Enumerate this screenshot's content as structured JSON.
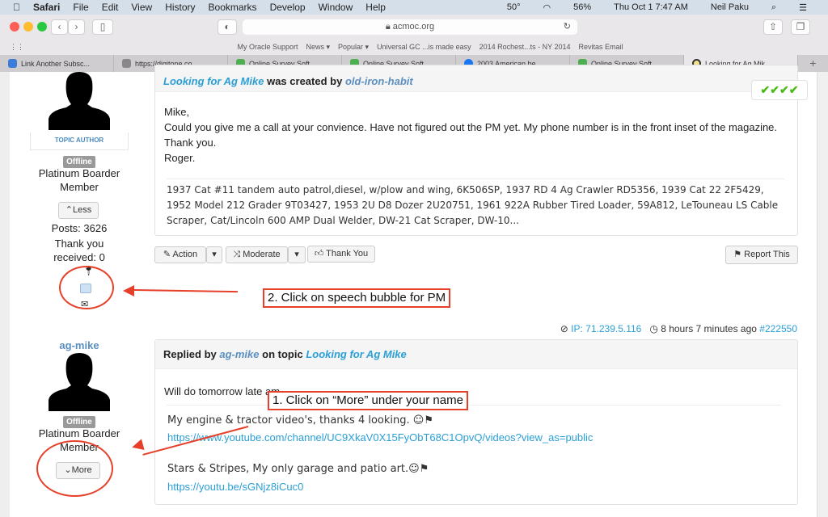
{
  "menubar": {
    "app": "Safari",
    "items": [
      "File",
      "Edit",
      "View",
      "History",
      "Bookmarks",
      "Develop",
      "Window",
      "Help"
    ],
    "weather": "50°",
    "battery": "56%",
    "datetime": "Thu Oct 1  7:47 AM",
    "user": "Neil Paku"
  },
  "browser": {
    "url": "acmoc.org",
    "bookmarks": [
      "My Oracle Support",
      "News ▾",
      "Popular ▾",
      "Universal GC ...is made easy",
      "2014 Rochest...ts - NY 2014",
      "Revitas Email"
    ],
    "tabs": [
      {
        "label": "Link Another Subsc...",
        "color": "#3b7dd8"
      },
      {
        "label": "https://digitone.co...",
        "color": "#888888"
      },
      {
        "label": "Online Survey Soft...",
        "color": "#4caf50"
      },
      {
        "label": "Online Survey Soft...",
        "color": "#4caf50"
      },
      {
        "label": "2003 American be...",
        "color": "#1877f2"
      },
      {
        "label": "Online Survey Soft...",
        "color": "#4caf50"
      },
      {
        "label": "Looking for Ag Mik...",
        "color": "#d4a017"
      }
    ]
  },
  "post1": {
    "topic": "Looking for Ag Mike",
    "created_text": "was created by",
    "author": "old-iron-habit",
    "badge": "TOPIC AUTHOR",
    "status": "Offline",
    "rank": "Platinum Boarder Member",
    "less": "Less",
    "posts": "Posts: 3626",
    "thanks": "Thank you received: 0",
    "body": [
      "Mike,",
      "Could you give me a call at your convience. Have not figured out the PM yet. My phone number is in the front inset of the magazine.",
      "Thank you.",
      "Roger."
    ],
    "signature": "1937 Cat #11 tandem auto patrol,diesel, w/plow and wing, 6K506SP, 1937 RD 4 Ag Crawler RD5356, 1939 Cat 22 2F5429, 1952 Model 212 Grader 9T03427, 1953 2U D8 Dozer 2U20751, 1961 922A Rubber Tired Loader, 59A812, LeTouneau LS Cable Scraper, Cat/Lincoln 600 AMP Dual Welder, DW-21 Cat Scraper, DW-10...",
    "actions": {
      "action": "Action",
      "moderate": "Moderate",
      "thank": "Thank You",
      "report": "Report This"
    }
  },
  "meta": {
    "ip": "IP: 71.239.5.116",
    "time": "8 hours 7 minutes ago",
    "id": "#222550"
  },
  "post2": {
    "username": "ag-mike",
    "replied": "Replied by",
    "author": "ag-mike",
    "on_topic": "on topic",
    "topic": "Looking for Ag Mike",
    "status": "Offline",
    "rank": "Platinum Boarder Member",
    "more": "More",
    "body": "Will do tomorrow late am.",
    "sig1": "My engine & tractor video's, thanks 4 looking.",
    "link1": "https://www.youtube.com/channel/UC9XkaV0X15FyObT68C1OpvQ/videos?view_as=public",
    "sig2": "Stars & Stripes, My only garage and patio art.",
    "link2": "https://youtu.be/sGNjz8iCuc0"
  },
  "annotations": {
    "step2": "2. Click on speech bubble for PM",
    "step1": "1. Click on “More” under your name",
    "color": "#e6402a"
  }
}
